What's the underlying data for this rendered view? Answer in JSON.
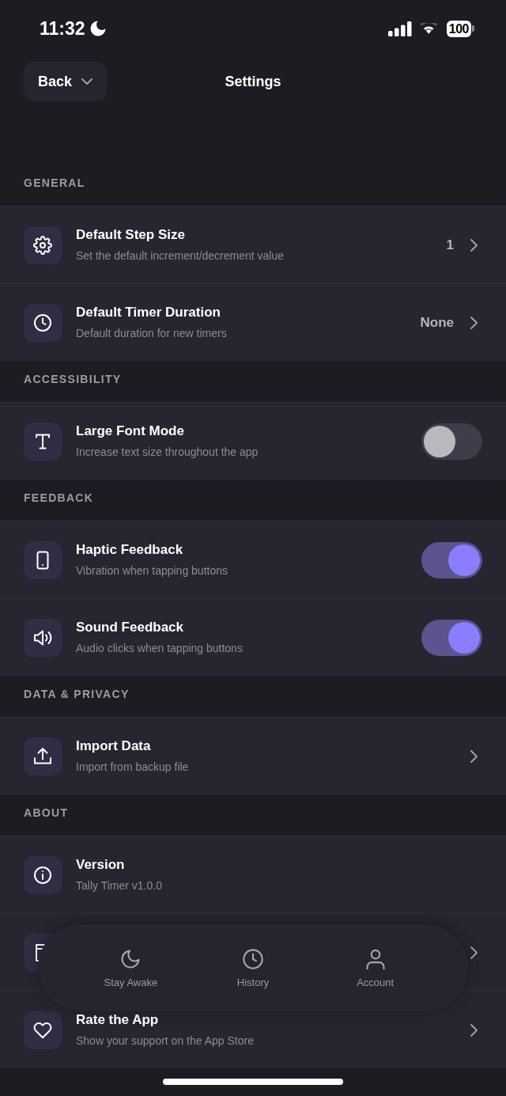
{
  "status_bar": {
    "time": "11:32",
    "battery": "100"
  },
  "header": {
    "back": "Back",
    "title": "Settings"
  },
  "sections": [
    {
      "title": "GENERAL",
      "rows": [
        {
          "kind": "link",
          "title": "Default Step Size",
          "subtitle": "Set the default increment/decrement value",
          "value": "1"
        },
        {
          "kind": "link",
          "title": "Default Timer Duration",
          "subtitle": "Default duration for new timers",
          "value": "None"
        }
      ]
    },
    {
      "title": "ACCESSIBILITY",
      "rows": [
        {
          "kind": "toggle",
          "title": "Large Font Mode",
          "subtitle": "Increase text size throughout the app",
          "on": false
        }
      ]
    },
    {
      "title": "FEEDBACK",
      "rows": [
        {
          "kind": "toggle",
          "title": "Haptic Feedback",
          "subtitle": "Vibration when tapping buttons",
          "on": true
        },
        {
          "kind": "toggle",
          "title": "Sound Feedback",
          "subtitle": "Audio clicks when tapping buttons",
          "on": true
        }
      ]
    },
    {
      "title": "DATA & PRIVACY",
      "rows": [
        {
          "kind": "link",
          "title": "Import Data",
          "subtitle": "Import from backup file"
        }
      ]
    },
    {
      "title": "ABOUT",
      "rows": [
        {
          "kind": "info",
          "title": "Version",
          "subtitle": "Tally Timer v1.0.0"
        },
        {
          "kind": "link"
        },
        {
          "kind": "link",
          "title": "Rate the App",
          "subtitle": "Show your support on the App Store"
        }
      ]
    }
  ],
  "tab_bar": {
    "items": [
      {
        "label": "Stay Awake"
      },
      {
        "label": "History"
      },
      {
        "label": "Account"
      }
    ]
  }
}
